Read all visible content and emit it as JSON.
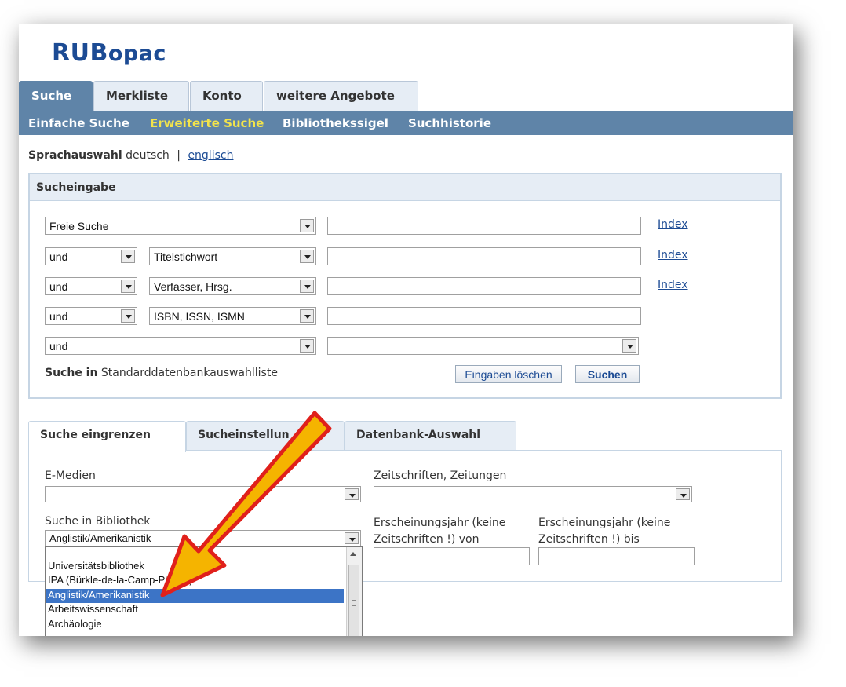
{
  "logo": {
    "bold": "RUB",
    "rest": "opac"
  },
  "main_tabs": [
    "Suche",
    "Merkliste",
    "Konto",
    "weitere Angebote"
  ],
  "sub_nav": [
    "Einfache Suche",
    "Erweiterte Suche",
    "Bibliothekssigel",
    "Suchhistorie"
  ],
  "lang": {
    "label": "Sprachauswahl",
    "current": "deutsch",
    "sep": "|",
    "other": "englisch"
  },
  "search_panel": {
    "title": "Sucheingabe",
    "rows": [
      {
        "field": "Freie Suche",
        "index": "Index"
      },
      {
        "op": "und",
        "field": "Titelstichwort",
        "index": "Index"
      },
      {
        "op": "und",
        "field": "Verfasser, Hrsg.",
        "index": "Index"
      },
      {
        "op": "und",
        "field": "ISBN, ISSN, ISMN"
      },
      {
        "field": "und"
      }
    ],
    "db_label": "Suche in",
    "db_value": "Standarddatenbankauswahlliste",
    "clear_button": "Eingaben löschen",
    "search_button": "Suchen"
  },
  "sub_tabs": [
    "Suche eingrenzen",
    "Sucheinstellungen",
    "Datenbank-Auswahl"
  ],
  "sub_tab_visible": "Sucheinstellun",
  "filters": {
    "e_media_label": "E-Medien",
    "journals_label": "Zeitschriften, Zeitungen",
    "library_label": "Suche in Bibliothek",
    "library_value": "Anglistik/Amerikanistik",
    "year_from_label_1": "Erscheinungsjahr (keine",
    "year_from_label_2": "Zeitschriften !) von",
    "year_to_label_1": "Erscheinungsjahr (keine",
    "year_to_label_2": "Zeitschriften !)  bis"
  },
  "dropdown_options": [
    "Universitätsbibliothek",
    "IPA (Bürkle-de-la-Camp-Platz 1)",
    "Anglistik/Amerikanistik",
    "Arbeitswissenschaft",
    "Archäologie"
  ],
  "dropdown_selected_index": 2,
  "colors": {
    "brand": "#1c4b94",
    "nav": "#5f84a8",
    "active_link": "#f3e44b",
    "highlight": "#3c74c6",
    "arrow_fill": "#f5b400",
    "arrow_stroke": "#e0201b"
  }
}
